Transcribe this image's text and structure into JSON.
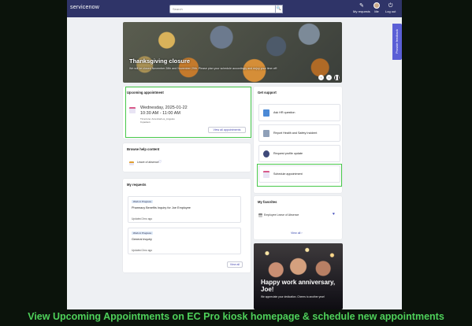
{
  "header": {
    "logo": "servicenow",
    "search_placeholder": "Search",
    "search_button": "🔍",
    "my_requests": "My requests",
    "me": "Me",
    "logout": "Log out"
  },
  "banner": {
    "title": "Thanksgiving closure",
    "text": "We will be closed November 28th and November 29th. Please plan your schedule accordingly and enjoy your time off!"
  },
  "feedback": "Provide feedback",
  "appointment": {
    "title": "Upcoming appointment",
    "date": "Wednesday, 2025-01-22",
    "time": "10:30 AM - 11:00 AM",
    "timezone": "Timezone: America/Los_Angeles",
    "mode": "In person",
    "view_all": "View all appointments"
  },
  "help": {
    "title": "Browse help content",
    "item": "Leave of absence"
  },
  "requests": {
    "title": "My requests",
    "items": [
      {
        "badge": "Work in Progress",
        "title": "Pharmacy Benefits Inquiry for Joe Employee",
        "updated": "Updated 2mo ago"
      },
      {
        "badge": "Work in Progress",
        "title": "General inquiry",
        "updated": "Updated 2mo ago"
      }
    ],
    "view_all": "View all"
  },
  "support": {
    "title": "Get support",
    "items": [
      {
        "label": "Ask HR question"
      },
      {
        "label": "Report Health and Safety Incident"
      },
      {
        "label": "Request profile update"
      },
      {
        "label": "Schedule appointment"
      }
    ]
  },
  "favorites": {
    "title": "My favorites",
    "item": "Employee Leave of Absence",
    "view_all": "View all"
  },
  "anniversary": {
    "title": "Happy work anniversary, Joe!",
    "text": "We appreciate your dedication. Cheers to another year!"
  },
  "caption": "View Upcoming Appointments on EC Pro kiosk homepage & schedule new appointments",
  "colors": {
    "header": "#2f3468",
    "highlight": "#47c84a",
    "caption": "#4ed15a"
  }
}
